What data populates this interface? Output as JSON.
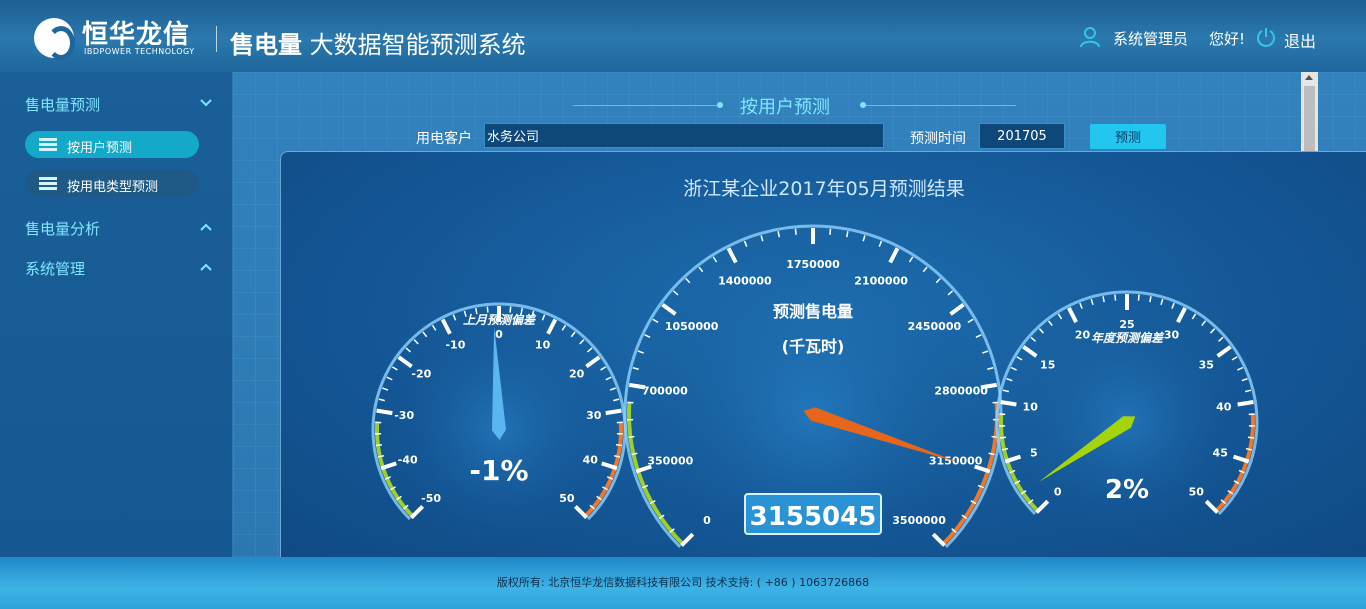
{
  "header": {
    "logo_cn": "恒华龙信",
    "logo_en": "IBDPOWER TECHNOLOGY",
    "title_bold": "售电量",
    "title_rest": " 大数据智能预测系统",
    "user_name": "系统管理员",
    "greeting": "您好!",
    "logout": "退出"
  },
  "sidebar": {
    "groups": [
      {
        "label": "售电量预测"
      },
      {
        "label": "售电量分析"
      },
      {
        "label": "系统管理"
      }
    ],
    "items": [
      {
        "label": "按用户预测"
      },
      {
        "label": "按用电类型预测"
      }
    ]
  },
  "form": {
    "section_title": "按用户预测",
    "customer_label": "用电客户",
    "customer_value": "水务公司",
    "time_label": "预测时间",
    "time_value": "201705",
    "predict_button": "预测"
  },
  "result": {
    "title": "浙江某企业2017年05月预测结果",
    "gauges": [
      {
        "title": "上月预测偏差",
        "ticks": [
          "-50",
          "-40",
          "-30",
          "-20",
          "-10",
          "0",
          "10",
          "20",
          "30",
          "40",
          "50"
        ],
        "min": -50,
        "max": 50,
        "value": -1,
        "display": "-1%",
        "needle_color": "#5ab6ee"
      },
      {
        "title": "预测售电量",
        "title2": "(千瓦时)",
        "ticks": [
          "0",
          "350000",
          "700000",
          "1050000",
          "1400000",
          "1750000",
          "2100000",
          "2450000",
          "2800000",
          "3150000",
          "3500000"
        ],
        "min": 0,
        "max": 3500000,
        "value": 3155045,
        "display": "3155045",
        "needle_color": "#e8661c"
      },
      {
        "title": "年度预测偏差",
        "ticks": [
          "0",
          "5",
          "10",
          "15",
          "20",
          "25",
          "30",
          "35",
          "40",
          "45",
          "50"
        ],
        "min": 0,
        "max": 50,
        "value": 2,
        "display": "2%",
        "needle_color": "#a6d40a"
      }
    ]
  },
  "footer": {
    "text": "版权所有: 北京恒华龙信数据科技有限公司 技术支持: ( +86 ) 1063726868"
  }
}
